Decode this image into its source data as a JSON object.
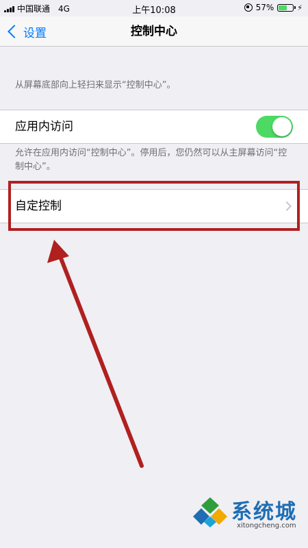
{
  "status_bar": {
    "carrier": "中国联通",
    "network": "4G",
    "time": "上午10:08",
    "battery_percent": "57%",
    "battery_level": 0.57
  },
  "nav": {
    "back_label": "设置",
    "title": "控制中心"
  },
  "footnote_top": "从屏幕底部向上轻扫来显示“控制中心”。",
  "access_within_apps": {
    "label": "应用内访问",
    "enabled": true
  },
  "footnote_access": "允许在应用内访问“控制中心”。停用后，您仍然可以从主屏幕访问“控制中心”。",
  "customize": {
    "label": "自定控制"
  },
  "annotation": {
    "color": "#b0201f"
  },
  "watermark": {
    "brand": "系统城",
    "url": "xitongcheng.com"
  },
  "colors": {
    "accent": "#007aff",
    "toggle_on": "#4cd964",
    "background": "#efeff4"
  }
}
